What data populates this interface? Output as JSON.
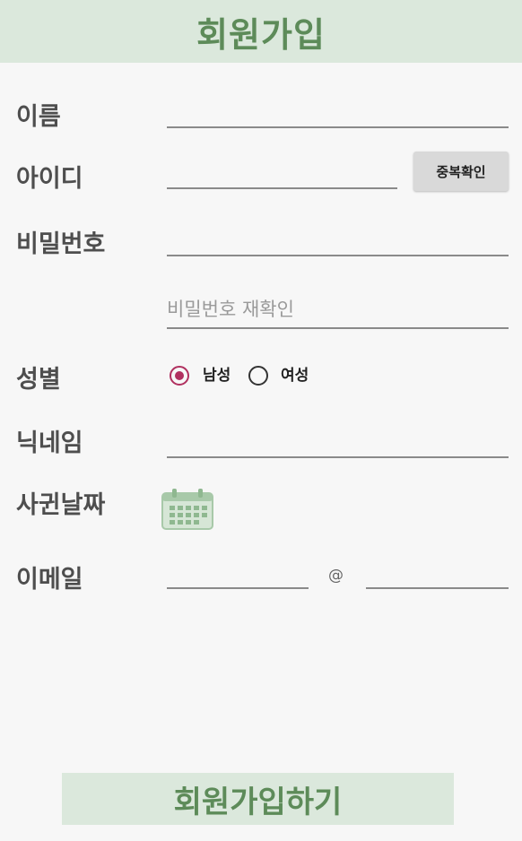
{
  "header": {
    "title": "회원가입"
  },
  "form": {
    "name_label": "이름",
    "id_label": "아이디",
    "dup_check_label": "중복확인",
    "password_label": "비밀번호",
    "password_confirm_placeholder": "비밀번호 재확인",
    "gender_label": "성별",
    "gender_options": [
      {
        "label": "남성",
        "selected": true
      },
      {
        "label": "여성",
        "selected": false
      }
    ],
    "nickname_label": "닉네임",
    "birthday_label": "사귄날짜",
    "email_label": "이메일",
    "email_at": "@"
  },
  "submit_label": "회원가입하기",
  "colors": {
    "header_bg": "#dbe8dc",
    "brand_green": "#5d8b59",
    "radio_accent": "#b0305f",
    "background": "#f7f7f7"
  },
  "icons": {
    "calendar": "calendar-icon"
  }
}
